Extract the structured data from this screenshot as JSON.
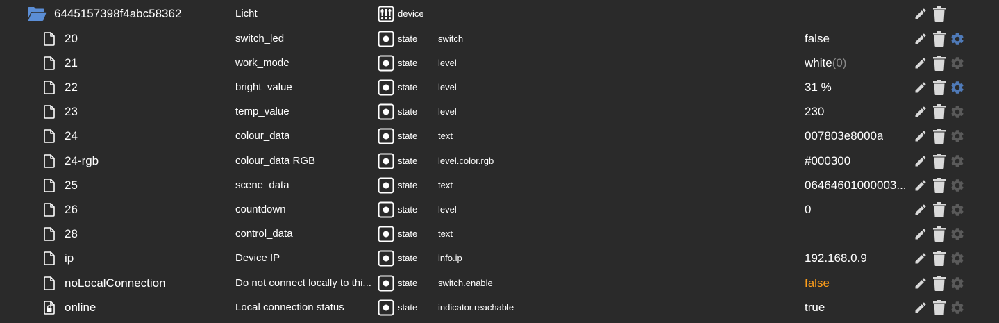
{
  "device": {
    "id": "6445157398f4abc58362",
    "name": "Licht",
    "type": "device",
    "icons": {
      "folder": "folder-open-icon",
      "device": "device-sliders-icon"
    }
  },
  "colors": {
    "background": "#2a2a2a",
    "text": "#ffffff",
    "muted": "#8a8a8a",
    "folder": "#5b8ed6",
    "gear_active": "#4f7ab8",
    "gear_inactive": "#5a5a5a",
    "warning_value": "#ff9f1a"
  },
  "states": [
    {
      "id": "20",
      "name": "switch_led",
      "type": "state",
      "role": "switch",
      "value": "false",
      "value_color": "#ffffff",
      "settings_active": true,
      "icon": "file-icon"
    },
    {
      "id": "21",
      "name": "work_mode",
      "type": "state",
      "role": "level",
      "value": "white",
      "value_suffix": "(0)",
      "value_color": "#ffffff",
      "settings_active": false,
      "icon": "file-icon"
    },
    {
      "id": "22",
      "name": "bright_value",
      "type": "state",
      "role": "level",
      "value": "31 %",
      "value_color": "#ffffff",
      "settings_active": true,
      "icon": "file-icon"
    },
    {
      "id": "23",
      "name": "temp_value",
      "type": "state",
      "role": "level",
      "value": "230",
      "value_color": "#ffffff",
      "settings_active": false,
      "icon": "file-icon"
    },
    {
      "id": "24",
      "name": "colour_data",
      "type": "state",
      "role": "text",
      "value": "007803e8000a",
      "value_color": "#ffffff",
      "settings_active": false,
      "icon": "file-icon"
    },
    {
      "id": "24-rgb",
      "name": "colour_data RGB",
      "type": "state",
      "role": "level.color.rgb",
      "value": "#000300",
      "value_color": "#ffffff",
      "settings_active": false,
      "icon": "file-icon"
    },
    {
      "id": "25",
      "name": "scene_data",
      "type": "state",
      "role": "text",
      "value": "06464601000003...",
      "value_color": "#ffffff",
      "settings_active": false,
      "icon": "file-icon"
    },
    {
      "id": "26",
      "name": "countdown",
      "type": "state",
      "role": "level",
      "value": "0",
      "value_color": "#ffffff",
      "settings_active": false,
      "icon": "file-icon"
    },
    {
      "id": "28",
      "name": "control_data",
      "type": "state",
      "role": "text",
      "value": "",
      "value_color": "#ffffff",
      "settings_active": false,
      "icon": "file-icon"
    },
    {
      "id": "ip",
      "name": "Device IP",
      "type": "state",
      "role": "info.ip",
      "value": "192.168.0.9",
      "value_color": "#ffffff",
      "settings_active": false,
      "icon": "file-icon"
    },
    {
      "id": "noLocalConnection",
      "name": "Do not connect locally to thi...",
      "type": "state",
      "role": "switch.enable",
      "value": "false",
      "value_color": "#ff9f1a",
      "settings_active": false,
      "icon": "file-icon"
    },
    {
      "id": "online",
      "name": "Local connection status",
      "type": "state",
      "role": "indicator.reachable",
      "value": "true",
      "value_color": "#ffffff",
      "settings_active": false,
      "icon": "file-lock-icon"
    }
  ]
}
